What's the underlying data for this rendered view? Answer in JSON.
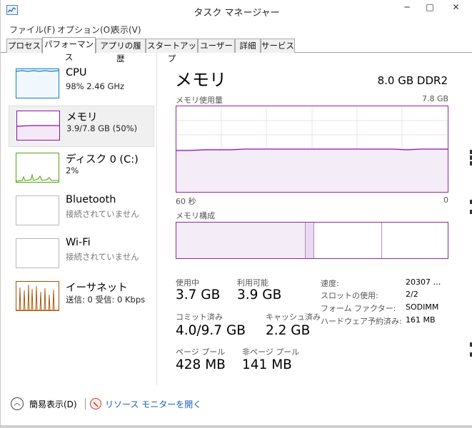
{
  "window": {
    "title": "タスク マネージャー"
  },
  "controls": {
    "minimize": "─",
    "maximize": "□",
    "close": "✕"
  },
  "menu": [
    "ファイル(F)",
    "オプション(O)",
    "表示(V)"
  ],
  "tabs": [
    "プロセス",
    "パフォーマンス",
    "アプリの履歴",
    "スタートアップ",
    "ユーザー",
    "詳細",
    "サービス"
  ],
  "active_tab": "パフォーマンス",
  "resources": [
    {
      "name": "CPU",
      "detail": "98% 2.46 GHz",
      "color": "#117dbb"
    },
    {
      "name": "メモリ",
      "detail": "3.9/7.8 GB (50%)",
      "color": "#8b12ae",
      "selected": true
    },
    {
      "name": "ディスク 0 (C:)",
      "detail": "2%",
      "color": "#4da60c"
    },
    {
      "name": "Bluetooth",
      "detail": "接続されていません",
      "color": "#a74f01"
    },
    {
      "name": "Wi-Fi",
      "detail": "接続されていません",
      "color": "#a74f01"
    },
    {
      "name": "イーサネット",
      "detail": "送信: 0 受信: 0 Kbps",
      "color": "#a74f01"
    }
  ],
  "memory": {
    "title": "メモリ",
    "spec": "8.0 GB DDR2",
    "usage_label": "メモリ使用量",
    "usage_max": "7.8 GB",
    "axis_left": "60 秒",
    "axis_right": "0",
    "composition_label": "メモリ構成",
    "usage_fraction": 0.5,
    "stats": {
      "in_use_label": "使用中",
      "in_use": "3.7 GB",
      "available_label": "利用可能",
      "available": "3.9 GB",
      "committed_label": "コミット済み",
      "committed": "4.0/9.7 GB",
      "cached_label": "キャッシュ済み",
      "cached": "2.2 GB",
      "paged_label": "ページ プール",
      "paged": "428 MB",
      "nonpaged_label": "非ページ プール",
      "nonpaged": "141 MB"
    },
    "details": [
      {
        "label": "速度:",
        "value": "20307 …"
      },
      {
        "label": "スロットの使用:",
        "value": "2/2"
      },
      {
        "label": "フォーム ファクター:",
        "value": "SODIMM"
      },
      {
        "label": "ハードウェア予約済み:",
        "value": "161 MB"
      }
    ]
  },
  "footer": {
    "fewer_details": "簡易表示(D)",
    "resource_monitor": "リソース モニターを開く"
  },
  "colors": {
    "memory_accent": "#8b12ae",
    "link": "#1a5fb4"
  }
}
